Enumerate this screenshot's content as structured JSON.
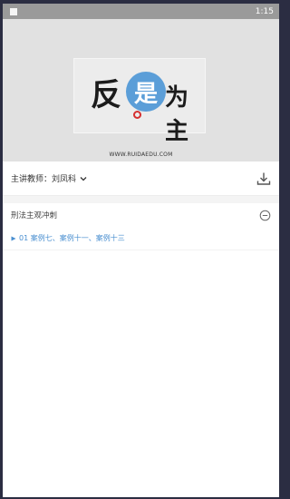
{
  "status_bar": {
    "time": "1:15",
    "notification_icon": "square-icon"
  },
  "hero": {
    "logo_chars": [
      "反",
      "是",
      "为主"
    ],
    "logo_url": "WWW.RUIDAEDU.COM"
  },
  "teacher": {
    "label": "主讲教师：刘凤科",
    "dropdown_icon": "chevron-down-icon",
    "download_icon": "download-icon"
  },
  "section": {
    "title": "刑法主观冲刺",
    "toggle_icon": "minus-circle-icon"
  },
  "lessons": [
    {
      "label": "01 案例七、案例十一、案例十三",
      "color": "#4a8fd0",
      "icon": "play-triangle-icon"
    }
  ],
  "colors": {
    "accent": "#4a8fd0",
    "hero_bg": "#e1e1e1",
    "status_bar": "#9a9a9a"
  }
}
